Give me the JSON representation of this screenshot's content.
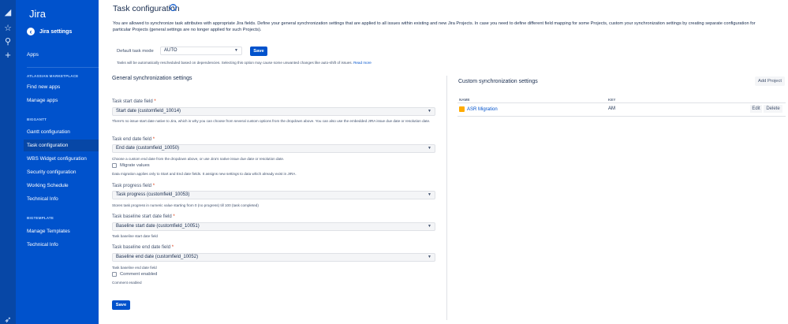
{
  "app": {
    "brand": "Jira"
  },
  "sidebar": {
    "settings_label": "Jira settings",
    "apps_label": "Apps",
    "sections": [
      {
        "heading": "ATLASSIAN MARKETPLACE",
        "items": [
          "Find new apps",
          "Manage apps"
        ]
      },
      {
        "heading": "BIGGANTT",
        "items": [
          "Gantt configuration",
          "Task configuration",
          "WBS Widget configuration",
          "Security configuration",
          "Working Schedule",
          "Technical Info"
        ]
      },
      {
        "heading": "BIGTEMPLATE",
        "items": [
          "Manage Templates",
          "Technical Info"
        ]
      }
    ],
    "active_item": "Task configuration"
  },
  "page": {
    "title": "Task configuration",
    "intro": "You are allowed to synchronize task attributes with appropriate Jira fields. Define your general synchronization settings that are applied to all issues within existing and new Jira Projects. In case you need to define different field mapping for some Projects, custom your synchronization settings by creating separate configuration for particular Projects (general settings are no longer applied for such Projects).",
    "default_mode": {
      "label": "Default task mode",
      "value": "AUTO",
      "save_label": "Save",
      "help": "Tasks will be automatically rescheduled based on dependencies. Selecting this option may cause some unwanted changes like auto-shift of issues.",
      "read_more": "Read more"
    }
  },
  "general": {
    "title": "General synchronization settings",
    "start": {
      "label": "Task start date field",
      "value": "Start date (customfield_10014)",
      "help": "There's no issue start date native to Jira, which is why you can choose from several custom options from the dropdown above. You can also use the embedded JIRA issue due date or resolution date."
    },
    "end": {
      "label": "Task end date field",
      "value": "End date (customfield_10050)",
      "help": "Choose a custom end date from the dropdown above, or use Jira's native issue due date or resolution date.",
      "migrate_label": "Migrate values",
      "migrate_help": "Data migration applies only to Start and End date fields. It assigns new settings to data which already exist in JIRA."
    },
    "progress": {
      "label": "Task progress field",
      "value": "Task progress (customfield_10053)",
      "help": "Stores task progress in numeric value starting from 0 (no progress) till 100 (task completed)"
    },
    "baseline_start": {
      "label": "Task baseline start date field",
      "value": "Baseline start date (customfield_10051)",
      "help": "Task baseline start date field"
    },
    "baseline_end": {
      "label": "Task baseline end date field",
      "value": "Baseline end date (customfield_10052)",
      "help": "Task baseline end date field"
    },
    "comment": {
      "label": "Comment enabled",
      "help": "Comment enabled"
    },
    "save_label": "Save",
    "required_mark": "*"
  },
  "custom": {
    "title": "Custom synchronization settings",
    "add_label": "Add Project",
    "columns": {
      "name": "NAME",
      "key": "KEY"
    },
    "rows": [
      {
        "name": "ASR Migration",
        "key": "AM",
        "edit": "Edit",
        "delete": "Delete"
      }
    ]
  }
}
